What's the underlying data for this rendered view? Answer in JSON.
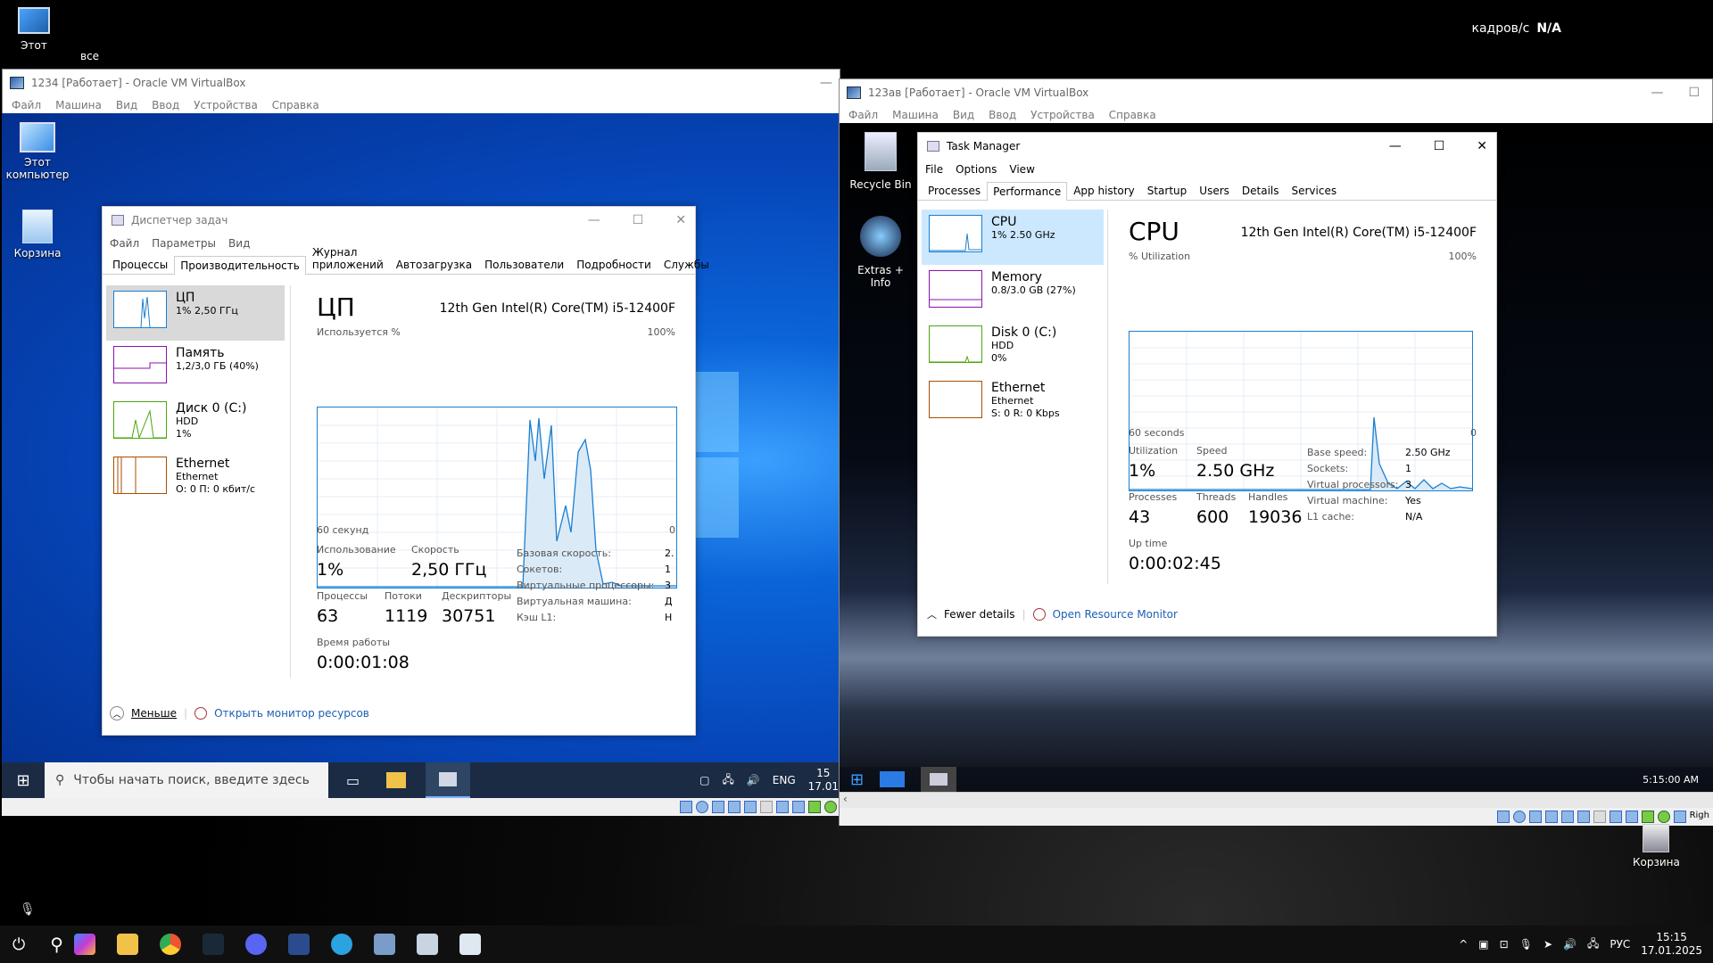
{
  "host": {
    "icons": [
      {
        "label": "Этот"
      },
      {
        "label": "все"
      }
    ],
    "fps_label": "кадров/с",
    "fps_value": "N/A",
    "bin_label": "Корзина",
    "taskbar": {
      "lang": "РУС",
      "time": "15:15",
      "date": "17.01.2025"
    }
  },
  "vm1": {
    "title": "1234 [Работает] - Oracle VM VirtualBox",
    "menu": [
      "Файл",
      "Машина",
      "Вид",
      "Ввод",
      "Устройства",
      "Справка"
    ],
    "desktop_icons": [
      {
        "label": "Этот компьютер"
      },
      {
        "label": "Корзина"
      }
    ],
    "taskbar": {
      "search_placeholder": "Чтобы начать поиск, введите здесь",
      "lang": "ENG",
      "time": "15",
      "date": "17.01"
    },
    "tm": {
      "title": "Диспетчер задач",
      "menu": [
        "Файл",
        "Параметры",
        "Вид"
      ],
      "tabs": [
        "Процессы",
        "Производительность",
        "Журнал приложений",
        "Автозагрузка",
        "Пользователи",
        "Подробности",
        "Службы"
      ],
      "side": [
        {
          "title": "ЦП",
          "sub1": "1% 2,50 ГГц",
          "sub2": "",
          "sub3": ""
        },
        {
          "title": "Память",
          "sub1": "1,2/3,0 ГБ (40%)",
          "sub2": "",
          "sub3": ""
        },
        {
          "title": "Диск 0 (C:)",
          "sub1": "HDD",
          "sub2": "1%",
          "sub3": ""
        },
        {
          "title": "Ethernet",
          "sub1": "Ethernet",
          "sub2": "О: 0 П: 0 кбит/с",
          "sub3": ""
        }
      ],
      "heading": "ЦП",
      "cpu_name": "12th Gen Intel(R) Core(TM) i5-12400F",
      "util_label": "Используется %",
      "pct_max": "100%",
      "time_left": "60 секунд",
      "time_right": "0",
      "stats": {
        "util_l": "Использование",
        "util_v": "1%",
        "speed_l": "Скорость",
        "speed_v": "2,50 ГГц",
        "proc_l": "Процессы",
        "proc_v": "63",
        "thr_l": "Потоки",
        "thr_v": "1119",
        "hnd_l": "Дескрипторы",
        "hnd_v": "30751",
        "up_l": "Время работы",
        "up_v": "0:00:01:08"
      },
      "specs": [
        {
          "k": "Базовая скорость:",
          "v": "2."
        },
        {
          "k": "Сокетов:",
          "v": "1"
        },
        {
          "k": "Виртуальные процессоры:",
          "v": "3"
        },
        {
          "k": "Виртуальная машина:",
          "v": "Д"
        },
        {
          "k": "Кэш L1:",
          "v": "Н"
        }
      ],
      "fewer": "Меньше",
      "open_monitor": "Открыть монитор ресурсов"
    }
  },
  "vm2": {
    "title": "123ав [Работает] - Oracle VM VirtualBox",
    "menu": [
      "Файл",
      "Машина",
      "Вид",
      "Ввод",
      "Устройства",
      "Справка"
    ],
    "desktop_icons": [
      {
        "label": "Recycle Bin"
      },
      {
        "label": "Extras + Info"
      }
    ],
    "taskbar": {
      "time": "5:15:00 AM"
    },
    "status_right": "Righ",
    "tm": {
      "title": "Task Manager",
      "menu": [
        "File",
        "Options",
        "View"
      ],
      "tabs": [
        "Processes",
        "Performance",
        "App history",
        "Startup",
        "Users",
        "Details",
        "Services"
      ],
      "side": [
        {
          "title": "CPU",
          "sub1": "1% 2.50 GHz",
          "sub2": "",
          "sub3": ""
        },
        {
          "title": "Memory",
          "sub1": "0.8/3.0 GB (27%)",
          "sub2": "",
          "sub3": ""
        },
        {
          "title": "Disk 0 (C:)",
          "sub1": "HDD",
          "sub2": "0%",
          "sub3": ""
        },
        {
          "title": "Ethernet",
          "sub1": "Ethernet",
          "sub2": "S: 0 R: 0 Kbps",
          "sub3": ""
        }
      ],
      "heading": "CPU",
      "cpu_name": "12th Gen Intel(R) Core(TM) i5-12400F",
      "util_label": "% Utilization",
      "pct_max": "100%",
      "time_left": "60 seconds",
      "time_right": "0",
      "stats": {
        "util_l": "Utilization",
        "util_v": "1%",
        "speed_l": "Speed",
        "speed_v": "2.50 GHz",
        "proc_l": "Processes",
        "proc_v": "43",
        "thr_l": "Threads",
        "thr_v": "600",
        "hnd_l": "Handles",
        "hnd_v": "19036",
        "up_l": "Up time",
        "up_v": "0:00:02:45"
      },
      "specs": [
        {
          "k": "Base speed:",
          "v": "2.50 GHz"
        },
        {
          "k": "Sockets:",
          "v": "1"
        },
        {
          "k": "Virtual processors:",
          "v": "3"
        },
        {
          "k": "Virtual machine:",
          "v": "Yes"
        },
        {
          "k": "L1 cache:",
          "v": "N/A"
        }
      ],
      "fewer": "Fewer details",
      "open_monitor": "Open Resource Monitor"
    }
  },
  "colors": {
    "cpu": "#1a7fd1",
    "mem": "#8b12ae",
    "disk": "#4da60c",
    "eth": "#a74f01"
  }
}
